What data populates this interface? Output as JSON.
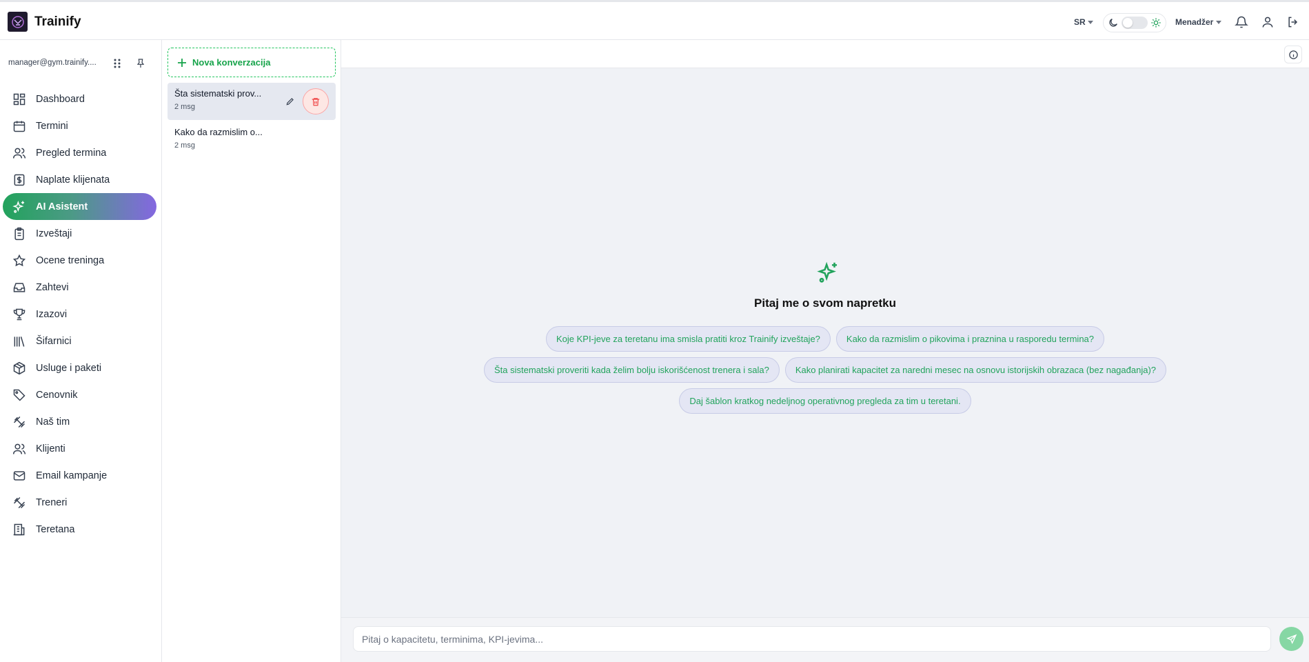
{
  "app": {
    "title": "Trainify",
    "logo_icon": "gym-logo-icon"
  },
  "topbar": {
    "language": "SR",
    "theme": {
      "moon_icon": "moon-icon",
      "sun_icon": "sun-icon",
      "mode": "light"
    },
    "role": "Menadžer",
    "icons": [
      "bell-icon",
      "user-icon",
      "logout-icon"
    ]
  },
  "sidebar": {
    "account": "manager@gym.trainify....",
    "items": [
      {
        "label": "Dashboard",
        "icon": "dashboard-icon"
      },
      {
        "label": "Termini",
        "icon": "calendar-icon"
      },
      {
        "label": "Pregled termina",
        "icon": "users-icon"
      },
      {
        "label": "Naplate klijenata",
        "icon": "dollar-icon"
      },
      {
        "label": "AI Asistent",
        "icon": "sparkles-icon",
        "active": true
      },
      {
        "label": "Izveštaji",
        "icon": "clipboard-icon"
      },
      {
        "label": "Ocene treninga",
        "icon": "star-icon"
      },
      {
        "label": "Zahtevi",
        "icon": "inbox-icon"
      },
      {
        "label": "Izazovi",
        "icon": "trophy-icon"
      },
      {
        "label": "Šifarnici",
        "icon": "library-icon"
      },
      {
        "label": "Usluge i paketi",
        "icon": "package-icon"
      },
      {
        "label": "Cenovnik",
        "icon": "tag-icon"
      },
      {
        "label": "Naš tim",
        "icon": "dumbbell-icon"
      },
      {
        "label": "Klijenti",
        "icon": "users-icon"
      },
      {
        "label": "Email kampanje",
        "icon": "mail-icon"
      },
      {
        "label": "Treneri",
        "icon": "dumbbell-icon"
      },
      {
        "label": "Teretana",
        "icon": "building-icon"
      }
    ]
  },
  "conversations": {
    "new_label": "Nova konverzacija",
    "items": [
      {
        "title": "Šta sistematski prov...",
        "meta": "2 msg",
        "active": true
      },
      {
        "title": "Kako da razmislim o...",
        "meta": "2 msg",
        "active": false
      }
    ]
  },
  "main": {
    "empty_title": "Pitaj me o svom napretku",
    "suggestions": [
      "Koje KPI-jeve za teretanu ima smisla pratiti kroz Trainify izveštaje?",
      "Kako da razmislim o pikovima i praznina u rasporedu termina?",
      "Šta sistematski proveriti kada želim bolju iskorišćenost trenera i sala?",
      "Kako planirati kapacitet za naredni mesec na osnovu istorijskih obrazaca (bez nagađanja)?",
      "Daj šablon kratkog nedeljnog operativnog pregleda za tim u teretani."
    ],
    "input_placeholder": "Pitaj o kapacitetu, terminima, KPI-jevima...",
    "input_value": ""
  },
  "colors": {
    "accent_green": "#22a35c",
    "accent_purple": "#8467e0",
    "danger": "#ef4444"
  }
}
